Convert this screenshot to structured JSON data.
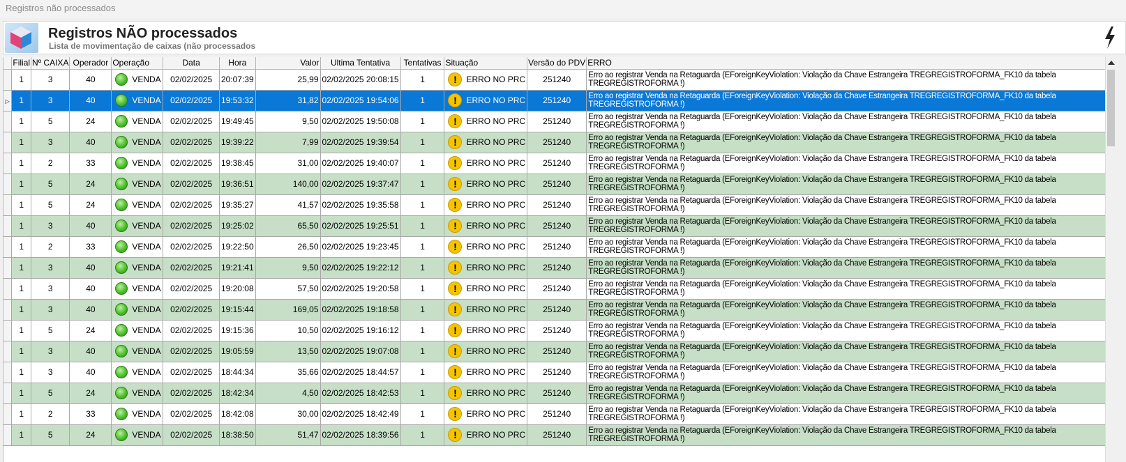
{
  "window": {
    "title": "Registros não processados"
  },
  "header": {
    "title": "Registros NÃO processados",
    "subtitle": "Lista de movimentação de caixas (não processados"
  },
  "columns": [
    "Filial",
    "Nº CAIXA",
    "Operador",
    "Operação",
    "Data",
    "Hora",
    "Valor",
    "Ultima Tentativa",
    "Tentativas",
    "Situação",
    "Versão do PDV",
    "ERRO"
  ],
  "selected_row": 1,
  "error_text": "Erro ao registrar Venda na Retaguarda (EForeignKeyViolation: Violação da Chave Estrangeira TREGREGISTROFORMA_FK10 da tabela TREGREGISTROFORMA !)",
  "rows": [
    {
      "filial": "1",
      "caixa": "3",
      "operador": "40",
      "operacao": "VENDA",
      "data": "02/02/2025",
      "hora": "20:07:39",
      "valor": "25,99",
      "ultima": "02/02/2025 20:08:15",
      "tentativas": "1",
      "situacao": "ERRO NO PRC",
      "versao": "251240"
    },
    {
      "filial": "1",
      "caixa": "3",
      "operador": "40",
      "operacao": "VENDA",
      "data": "02/02/2025",
      "hora": "19:53:32",
      "valor": "31,82",
      "ultima": "02/02/2025 19:54:06",
      "tentativas": "1",
      "situacao": "ERRO NO PRC",
      "versao": "251240"
    },
    {
      "filial": "1",
      "caixa": "5",
      "operador": "24",
      "operacao": "VENDA",
      "data": "02/02/2025",
      "hora": "19:49:45",
      "valor": "9,50",
      "ultima": "02/02/2025 19:50:08",
      "tentativas": "1",
      "situacao": "ERRO NO PRC",
      "versao": "251240"
    },
    {
      "filial": "1",
      "caixa": "3",
      "operador": "40",
      "operacao": "VENDA",
      "data": "02/02/2025",
      "hora": "19:39:22",
      "valor": "7,99",
      "ultima": "02/02/2025 19:39:54",
      "tentativas": "1",
      "situacao": "ERRO NO PRC",
      "versao": "251240"
    },
    {
      "filial": "1",
      "caixa": "2",
      "operador": "33",
      "operacao": "VENDA",
      "data": "02/02/2025",
      "hora": "19:38:45",
      "valor": "31,00",
      "ultima": "02/02/2025 19:40:07",
      "tentativas": "1",
      "situacao": "ERRO NO PRC",
      "versao": "251240"
    },
    {
      "filial": "1",
      "caixa": "5",
      "operador": "24",
      "operacao": "VENDA",
      "data": "02/02/2025",
      "hora": "19:36:51",
      "valor": "140,00",
      "ultima": "02/02/2025 19:37:47",
      "tentativas": "1",
      "situacao": "ERRO NO PRC",
      "versao": "251240"
    },
    {
      "filial": "1",
      "caixa": "5",
      "operador": "24",
      "operacao": "VENDA",
      "data": "02/02/2025",
      "hora": "19:35:27",
      "valor": "41,57",
      "ultima": "02/02/2025 19:35:58",
      "tentativas": "1",
      "situacao": "ERRO NO PRC",
      "versao": "251240"
    },
    {
      "filial": "1",
      "caixa": "3",
      "operador": "40",
      "operacao": "VENDA",
      "data": "02/02/2025",
      "hora": "19:25:02",
      "valor": "65,50",
      "ultima": "02/02/2025 19:25:51",
      "tentativas": "1",
      "situacao": "ERRO NO PRC",
      "versao": "251240"
    },
    {
      "filial": "1",
      "caixa": "2",
      "operador": "33",
      "operacao": "VENDA",
      "data": "02/02/2025",
      "hora": "19:22:50",
      "valor": "26,50",
      "ultima": "02/02/2025 19:23:45",
      "tentativas": "1",
      "situacao": "ERRO NO PRC",
      "versao": "251240"
    },
    {
      "filial": "1",
      "caixa": "3",
      "operador": "40",
      "operacao": "VENDA",
      "data": "02/02/2025",
      "hora": "19:21:41",
      "valor": "9,50",
      "ultima": "02/02/2025 19:22:12",
      "tentativas": "1",
      "situacao": "ERRO NO PRC",
      "versao": "251240"
    },
    {
      "filial": "1",
      "caixa": "3",
      "operador": "40",
      "operacao": "VENDA",
      "data": "02/02/2025",
      "hora": "19:20:08",
      "valor": "57,50",
      "ultima": "02/02/2025 19:20:58",
      "tentativas": "1",
      "situacao": "ERRO NO PRC",
      "versao": "251240"
    },
    {
      "filial": "1",
      "caixa": "3",
      "operador": "40",
      "operacao": "VENDA",
      "data": "02/02/2025",
      "hora": "19:15:44",
      "valor": "169,05",
      "ultima": "02/02/2025 19:18:58",
      "tentativas": "1",
      "situacao": "ERRO NO PRC",
      "versao": "251240"
    },
    {
      "filial": "1",
      "caixa": "5",
      "operador": "24",
      "operacao": "VENDA",
      "data": "02/02/2025",
      "hora": "19:15:36",
      "valor": "10,50",
      "ultima": "02/02/2025 19:16:12",
      "tentativas": "1",
      "situacao": "ERRO NO PRC",
      "versao": "251240"
    },
    {
      "filial": "1",
      "caixa": "3",
      "operador": "40",
      "operacao": "VENDA",
      "data": "02/02/2025",
      "hora": "19:05:59",
      "valor": "13,50",
      "ultima": "02/02/2025 19:07:08",
      "tentativas": "1",
      "situacao": "ERRO NO PRC",
      "versao": "251240"
    },
    {
      "filial": "1",
      "caixa": "3",
      "operador": "40",
      "operacao": "VENDA",
      "data": "02/02/2025",
      "hora": "18:44:34",
      "valor": "35,66",
      "ultima": "02/02/2025 18:44:57",
      "tentativas": "1",
      "situacao": "ERRO NO PRC",
      "versao": "251240"
    },
    {
      "filial": "1",
      "caixa": "5",
      "operador": "24",
      "operacao": "VENDA",
      "data": "02/02/2025",
      "hora": "18:42:34",
      "valor": "4,50",
      "ultima": "02/02/2025 18:42:53",
      "tentativas": "1",
      "situacao": "ERRO NO PRC",
      "versao": "251240"
    },
    {
      "filial": "1",
      "caixa": "2",
      "operador": "33",
      "operacao": "VENDA",
      "data": "02/02/2025",
      "hora": "18:42:08",
      "valor": "30,00",
      "ultima": "02/02/2025 18:42:49",
      "tentativas": "1",
      "situacao": "ERRO NO PRC",
      "versao": "251240"
    },
    {
      "filial": "1",
      "caixa": "5",
      "operador": "24",
      "operacao": "VENDA",
      "data": "02/02/2025",
      "hora": "18:38:50",
      "valor": "51,47",
      "ultima": "02/02/2025 18:39:56",
      "tentativas": "1",
      "situacao": "ERRO NO PRC",
      "versao": "251240"
    }
  ]
}
